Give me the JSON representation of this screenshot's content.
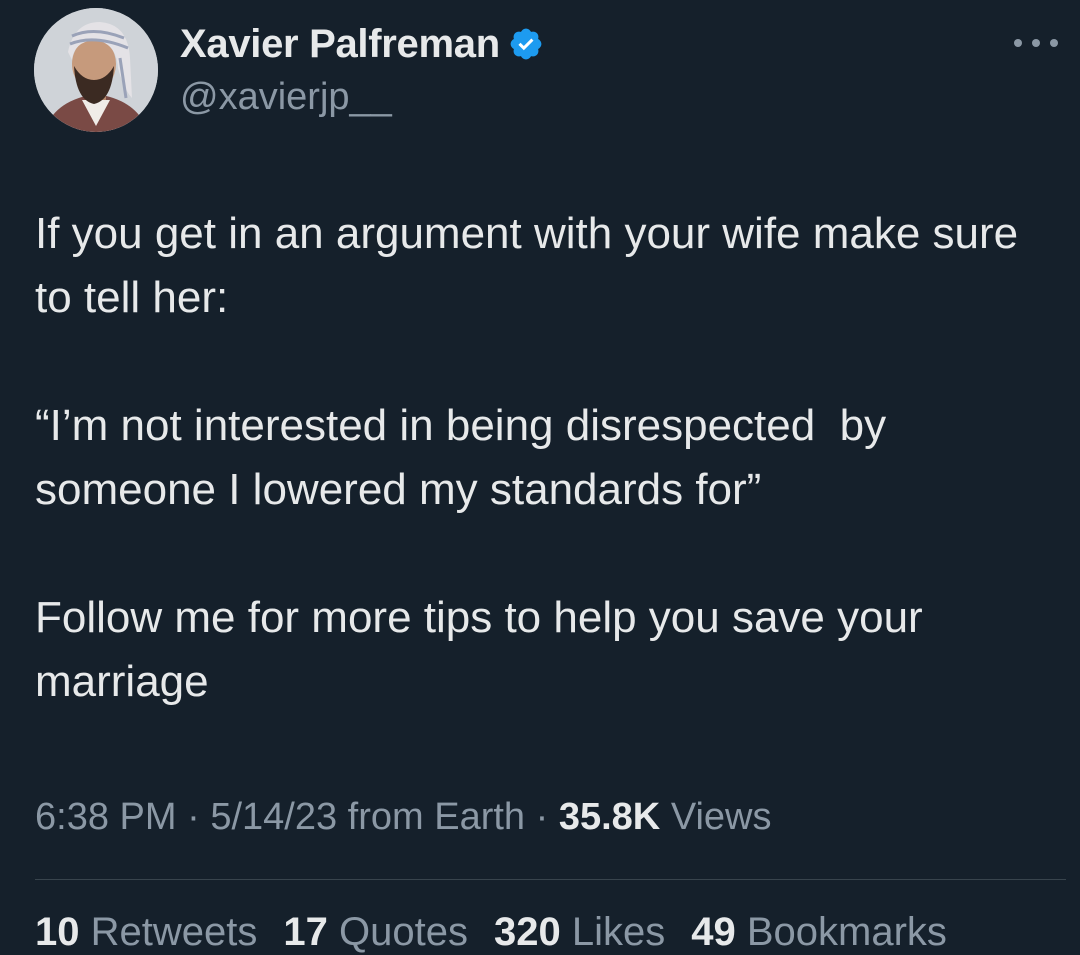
{
  "author": {
    "display_name": "Xavier Palfreman",
    "handle": "@xavierjp__",
    "verified_icon": "verified-badge-icon",
    "verified_color": "#1d9bf0"
  },
  "tweet": {
    "paragraphs": [
      "If you get in an argument with your wife make sure to tell her:",
      "“I’m not interested in being disrespected  by someone I lowered my standards for”",
      "Follow me for more tips to help you save your marriage"
    ]
  },
  "meta": {
    "time": "6:38 PM",
    "separator": " · ",
    "date": "5/14/23",
    "source": "from Earth",
    "views_count": "35.8K",
    "views_label": "Views"
  },
  "stats": [
    {
      "count": "10",
      "label": "Retweets"
    },
    {
      "count": "17",
      "label": "Quotes"
    },
    {
      "count": "320",
      "label": "Likes"
    },
    {
      "count": "49",
      "label": "Bookmarks"
    }
  ],
  "colors": {
    "background": "#15202b",
    "text": "#e7e9ea",
    "secondary": "#8b98a5",
    "divider": "#38444d"
  }
}
